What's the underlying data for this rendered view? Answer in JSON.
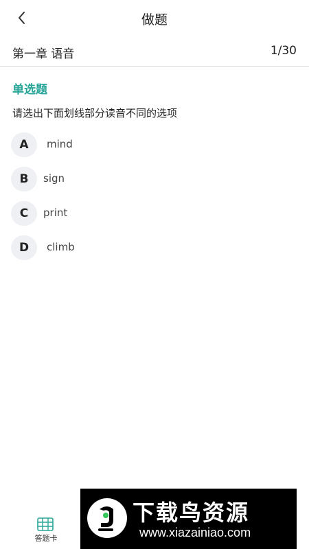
{
  "header": {
    "title": "做题",
    "back_icon": "chevron-left-icon"
  },
  "chapter": {
    "title": "第一章 语音",
    "counter": "1/30"
  },
  "question": {
    "type": "单选题",
    "text": "请选出下面划线部分读音不同的选项",
    "options": [
      {
        "letter": "A",
        "text": "mind"
      },
      {
        "letter": "B",
        "text": "sign"
      },
      {
        "letter": "C",
        "text": "print"
      },
      {
        "letter": "D",
        "text": "climb"
      }
    ]
  },
  "bottom": {
    "answer_card_label": "答题卡",
    "answer_card_icon": "grid-icon"
  },
  "watermark": {
    "title": "下载鸟资源",
    "url": "www.xiazainiao.com"
  },
  "colors": {
    "accent": "#2aa59a",
    "badge_bg": "#eef0f3",
    "divider": "#dcdcdc"
  }
}
